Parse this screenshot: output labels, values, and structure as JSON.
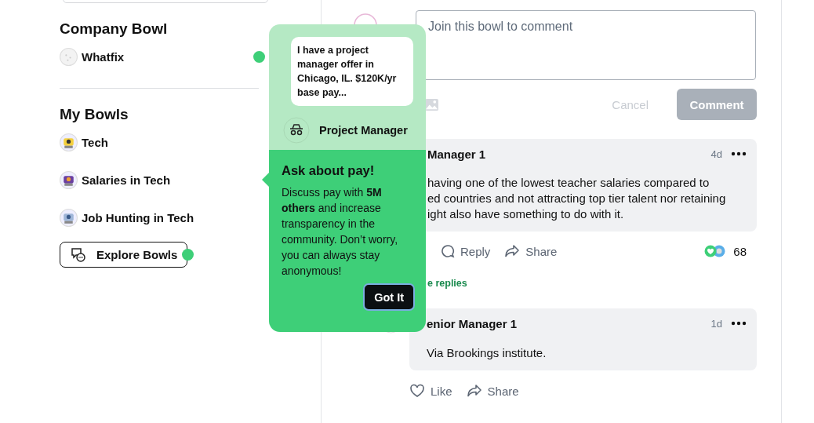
{
  "sidebar": {
    "company_bowl": {
      "title": "Company Bowl",
      "items": [
        {
          "name": "Whatfix",
          "has_update": true
        }
      ]
    },
    "my_bowls": {
      "title": "My Bowls",
      "items": [
        {
          "name": "Tech"
        },
        {
          "name": "Salaries in Tech"
        },
        {
          "name": "Job Hunting in Tech"
        }
      ]
    },
    "explore_button": {
      "label": "Explore Bowls",
      "has_update": true
    }
  },
  "composer": {
    "placeholder": "Join this bowl to comment",
    "cancel": "Cancel",
    "submit": "Comment"
  },
  "comments": [
    {
      "author": "Manager 1",
      "time": "4d",
      "body": "having one of the lowest teacher salaries compared to\ned countries and not attracting top tier talent nor retaining\night also have something to do with it.",
      "actions": [
        {
          "kind": "reply",
          "label": "Reply"
        },
        {
          "kind": "share",
          "label": "Share"
        }
      ],
      "reaction_count": "68",
      "more_replies": "e replies"
    },
    {
      "author": "enior Manager 1",
      "time": "1d",
      "body": "Via Brookings institute.",
      "actions": [
        {
          "kind": "like",
          "label": "Like"
        },
        {
          "kind": "share",
          "label": "Share"
        }
      ]
    }
  ],
  "tooltip": {
    "preview": {
      "message": "I have a project manager offer in Chicago, IL. $120K/yr base pay...",
      "author": "Project Manager"
    },
    "title": "Ask about pay!",
    "body": "Discuss pay with **5M others** and increase transparency in the community. Don’t worry, you can always stay anonymous!",
    "button": "Got It"
  }
}
